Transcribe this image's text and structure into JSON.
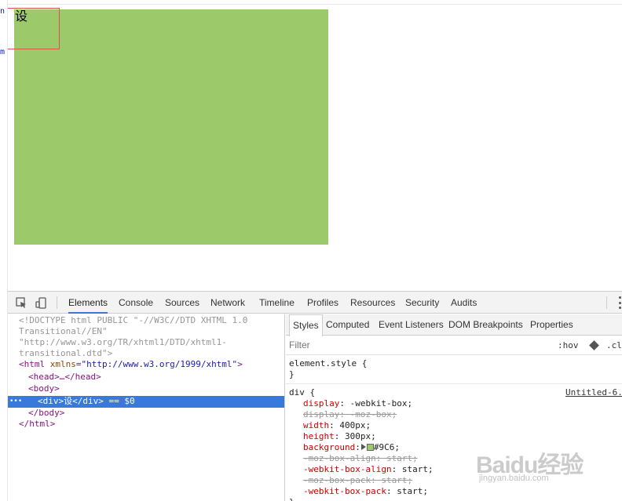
{
  "page": {
    "box_text": "设",
    "box_color": "#9CC96A",
    "hover_outline_color": "#d9534f",
    "left_strip_chars": [
      "n",
      "m"
    ]
  },
  "devtools": {
    "toolbar_tabs": [
      {
        "label": "Elements",
        "active": true
      },
      {
        "label": "Console"
      },
      {
        "label": "Sources"
      },
      {
        "label": "Network"
      },
      {
        "label": "Timeline"
      },
      {
        "label": "Profiles"
      },
      {
        "label": "Resources"
      },
      {
        "label": "Security"
      },
      {
        "label": "Audits"
      }
    ],
    "toolbar_icons": [
      "inspect-element-icon",
      "device-mode-icon",
      "more-options-icon"
    ],
    "accent_color": "#3879d9",
    "elements": {
      "doctype_line1": "<!DOCTYPE html PUBLIC \"-//W3C//DTD XHTML 1.0",
      "doctype_line2": "Transitional//EN\"",
      "doctype_line3": "\"http://www.w3.org/TR/xhtml1/DTD/xhtml1-",
      "doctype_line4": "transitional.dtd\">",
      "html_open_tag": "<html",
      "html_attr_name": "xmlns",
      "html_attr_value": "\"http://www.w3.org/1999/xhtml\"",
      "html_open_close": ">",
      "head_line": "<head>…</head>",
      "body_open": "<body>",
      "selected_dots": "•••",
      "selected_line": "<div>设</div> == $0",
      "body_close": "</body>",
      "html_close": "</html>"
    },
    "styles": {
      "tabs": [
        {
          "label": "Styles",
          "active": true
        },
        {
          "label": "Computed"
        },
        {
          "label": "Event Listeners"
        },
        {
          "label": "DOM Breakpoints"
        },
        {
          "label": "Properties"
        }
      ],
      "filter_placeholder": "Filter",
      "hov_label": ":hov",
      "cls_label": ".cl",
      "element_style_open": "element.style {",
      "close_brace": "}",
      "div_rule_selector": "div {",
      "source_link": "Untitled-6.",
      "declarations": [
        {
          "prop": "display",
          "value": "-webkit-box",
          "struck": false
        },
        {
          "prop": "display",
          "value": "-moz-box",
          "struck": true
        },
        {
          "prop": "width",
          "value": "400px",
          "struck": false
        },
        {
          "prop": "height",
          "value": "300px",
          "struck": false
        },
        {
          "prop": "background",
          "value": "#9C6",
          "struck": false,
          "swatch": true
        },
        {
          "prop": "-moz-box-align",
          "value": "start",
          "struck": true
        },
        {
          "prop": "-webkit-box-align",
          "value": "start",
          "struck": false
        },
        {
          "prop": "-moz-box-pack",
          "value": "start",
          "struck": true
        },
        {
          "prop": "-webkit-box-pack",
          "value": "start",
          "struck": false
        }
      ]
    }
  },
  "watermark": {
    "logo": "Baidu经验",
    "url": "jingyan.baidu.com"
  }
}
